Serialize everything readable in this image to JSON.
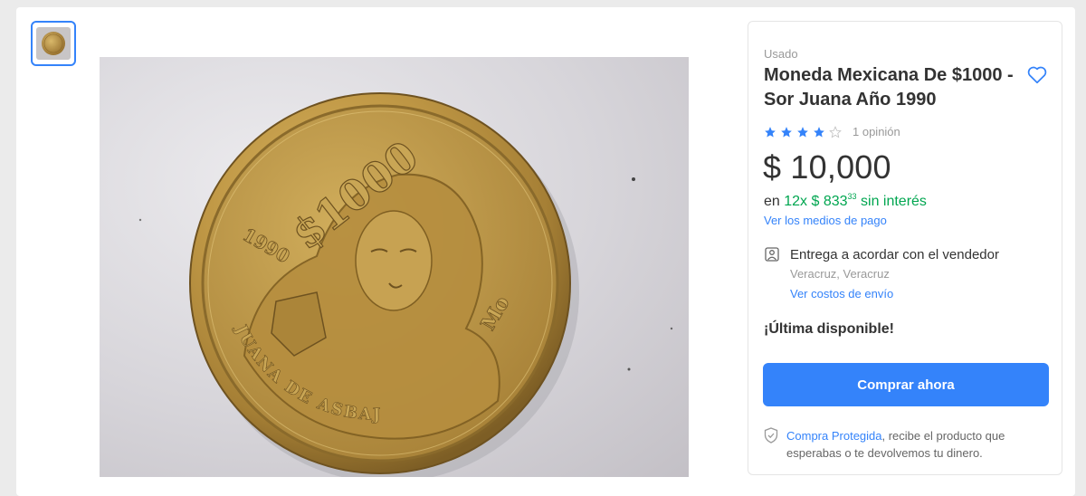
{
  "gallery": {
    "thumbnail_alt": "coin thumbnail"
  },
  "product": {
    "condition": "Usado",
    "title": "Moneda Mexicana De $1000 - Sor Juana Año 1990",
    "rating_stars": 4,
    "rating_max": 5,
    "rating_text": "1 opinión",
    "price": "$ 10,000",
    "installments_prefix": "en ",
    "installments_count": "12x",
    "installments_amount": "$ 833",
    "installments_cents": "33",
    "installments_suffix": " sin interés",
    "payment_link": "Ver los medios de pago"
  },
  "delivery": {
    "title": "Entrega a acordar con el vendedor",
    "location": "Veracruz, Veracruz",
    "shipping_link": "Ver costos de envío"
  },
  "stock": {
    "label": "¡Última disponible!"
  },
  "actions": {
    "buy_now": "Comprar ahora"
  },
  "protection": {
    "link": "Compra Protegida",
    "text": ", recibe el producto que esperabas o te devolvemos tu dinero."
  },
  "coin": {
    "denomination": "$1000",
    "year": "1990",
    "legend": "JUANA DE ASBAJE",
    "mint_mark": "Mo"
  },
  "colors": {
    "accent": "#3483fa",
    "green": "#00a650",
    "coin_gold": "#b8913f"
  }
}
